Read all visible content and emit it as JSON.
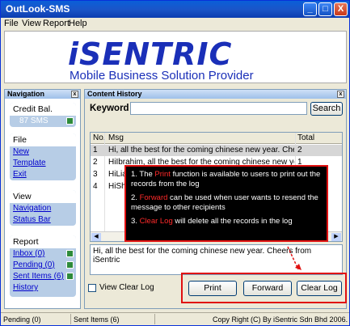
{
  "window": {
    "title": "OutLook-SMS",
    "min_glyph": "_",
    "max_glyph": "□",
    "close_glyph": "X"
  },
  "menu": [
    "File",
    "View",
    "Report",
    "Help"
  ],
  "logo": {
    "brand": "iSENTRIC",
    "tagline": "Mobile Business Solution Provider"
  },
  "navigation": {
    "title": "Navigation",
    "close": "x",
    "credit": {
      "heading": "Credit Bal.",
      "value": "87 SMS"
    },
    "file": {
      "heading": "File",
      "items": [
        "New",
        "Template",
        "Exit"
      ]
    },
    "view": {
      "heading": "View",
      "items": [
        "Navigation",
        "Status Bar"
      ]
    },
    "report": {
      "heading": "Report",
      "items": [
        "Inbox (0)",
        "Pending (0)",
        "Sent Items (6)",
        "History"
      ]
    }
  },
  "content": {
    "title": "Content History",
    "close": "x",
    "keyword_label": "Keyword",
    "keyword_value": "",
    "search_label": "Search",
    "columns": [
      "No.",
      "Msg",
      "Total"
    ],
    "rows": [
      {
        "no": "1",
        "msg": "Hi, all the best for the coming chinese new year. Chee",
        "total": "2"
      },
      {
        "no": "2",
        "msg": "HiIbrahim, all the best for the coming chinese new yea",
        "total": "1"
      },
      {
        "no": "3",
        "msg": "HiLian",
        "total": ""
      },
      {
        "no": "4",
        "msg": "HiShu",
        "total": ""
      }
    ],
    "message_preview": "Hi, all the best for the coming chinese new year. Cheers from iSentric",
    "view_clear_log": "View Clear Log",
    "buttons": {
      "print": "Print",
      "forward": "Forward",
      "clear_log": "Clear Log"
    }
  },
  "callout": {
    "line1_num": "1. The ",
    "line1_hl": "Print",
    "line1_rest": " function is available to users to print out the records from the log",
    "line2_num": "2. ",
    "line2_hl": "Forward",
    "line2_rest": " can be used when user wants to resend the message to other recipients",
    "line3_num": "3. ",
    "line3_hl": "Clear Log",
    "line3_rest": " will delete all the records in the log"
  },
  "statusbar": {
    "pending": "Pending (0)",
    "sent": "Sent Items (6)",
    "copyright": "Copy Right (C) By iSentric Sdn Bhd 2006."
  },
  "colors": {
    "accent": "#1a2fb8",
    "highlight_red": "#e01010"
  }
}
